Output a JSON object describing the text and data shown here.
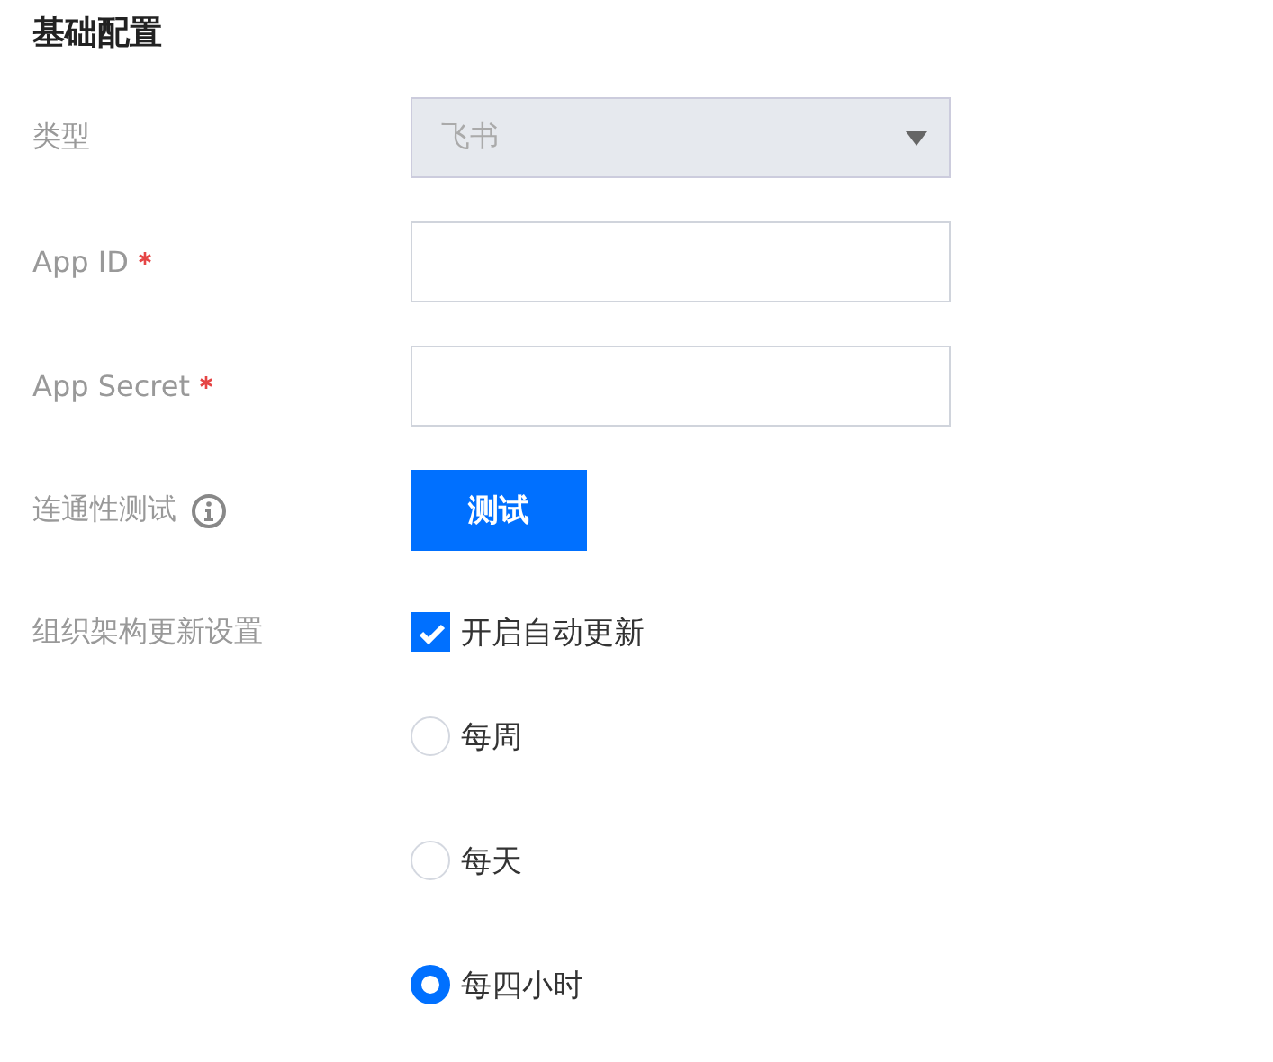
{
  "section_title": "基础配置",
  "fields": [
    {
      "kind": "select",
      "label": "类型",
      "required": false,
      "value": "飞书",
      "disabled": true
    },
    {
      "kind": "input",
      "label": "App ID",
      "required": true
    },
    {
      "kind": "input",
      "label": "App Secret",
      "required": true
    },
    {
      "kind": "button",
      "label": "连通性测试",
      "info": true,
      "button": "测试"
    },
    {
      "kind": "update",
      "label": "组织架构更新设置",
      "checkbox": {
        "label": "开启自动更新",
        "checked": true
      },
      "options": [
        {
          "label": "每周",
          "selected": false
        },
        {
          "label": "每天",
          "selected": false
        },
        {
          "label": "每四小时",
          "selected": true
        }
      ]
    }
  ]
}
